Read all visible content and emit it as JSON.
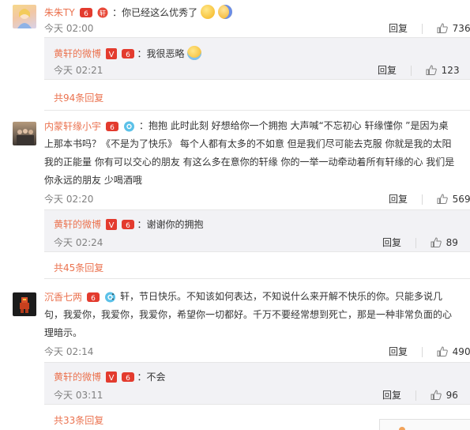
{
  "comments": [
    {
      "user": "朱朱TY",
      "text": "：你已经这么优秀了",
      "time": "今天 02:00",
      "reply_label": "回复",
      "likes": "736",
      "sub_reply": {
        "user": "黄轩的微博",
        "text": "：我很恶略",
        "time": "今天 02:21",
        "reply_label": "回复",
        "likes": "123"
      },
      "more": "共94条回复"
    },
    {
      "user": "内蒙轩缘小宇",
      "text": "：抱抱 此时此刻  好想给你一个拥抱 大声喊“不忘初心 轩缘懂你 ”是因为桌上那本书吗？《不是为了快乐》 每个人都有太多的不如意 但是我们尽可能去克服  你就是我的太阳  我的正能量  你有可以交心的朋友 有这么多在意你的轩缘  你的一举一动牵动着所有轩缘的心  我们是你永远的朋友 少喝酒哦",
      "time": "今天 02:20",
      "reply_label": "回复",
      "likes": "569",
      "sub_reply": {
        "user": "黄轩的微博",
        "text": "：谢谢你的拥抱",
        "time": "今天 02:24",
        "reply_label": "回复",
        "likes": "89"
      },
      "more": "共45条回复"
    },
    {
      "user": "沉香七两",
      "text": "：轩，节日快乐。不知该如何表达，不知说什么来开解不快乐的你。只能多说几句，我爱你，我爱你，我爱你，希望你一切都好。千万不要经常想到死亡，那是一种非常负面的心理暗示。",
      "time": "今天 02:14",
      "reply_label": "回复",
      "likes": "490",
      "sub_reply": {
        "user": "黄轩的微博",
        "text": "：不会",
        "time": "今天 03:11",
        "reply_label": "回复",
        "likes": "96"
      },
      "more": "共33条回复"
    }
  ],
  "colors": {
    "username": "#eb7350",
    "reply_bg": "#f2f2f5",
    "vip_red": "#e33b2e",
    "verified_orange": "#f5a623"
  }
}
